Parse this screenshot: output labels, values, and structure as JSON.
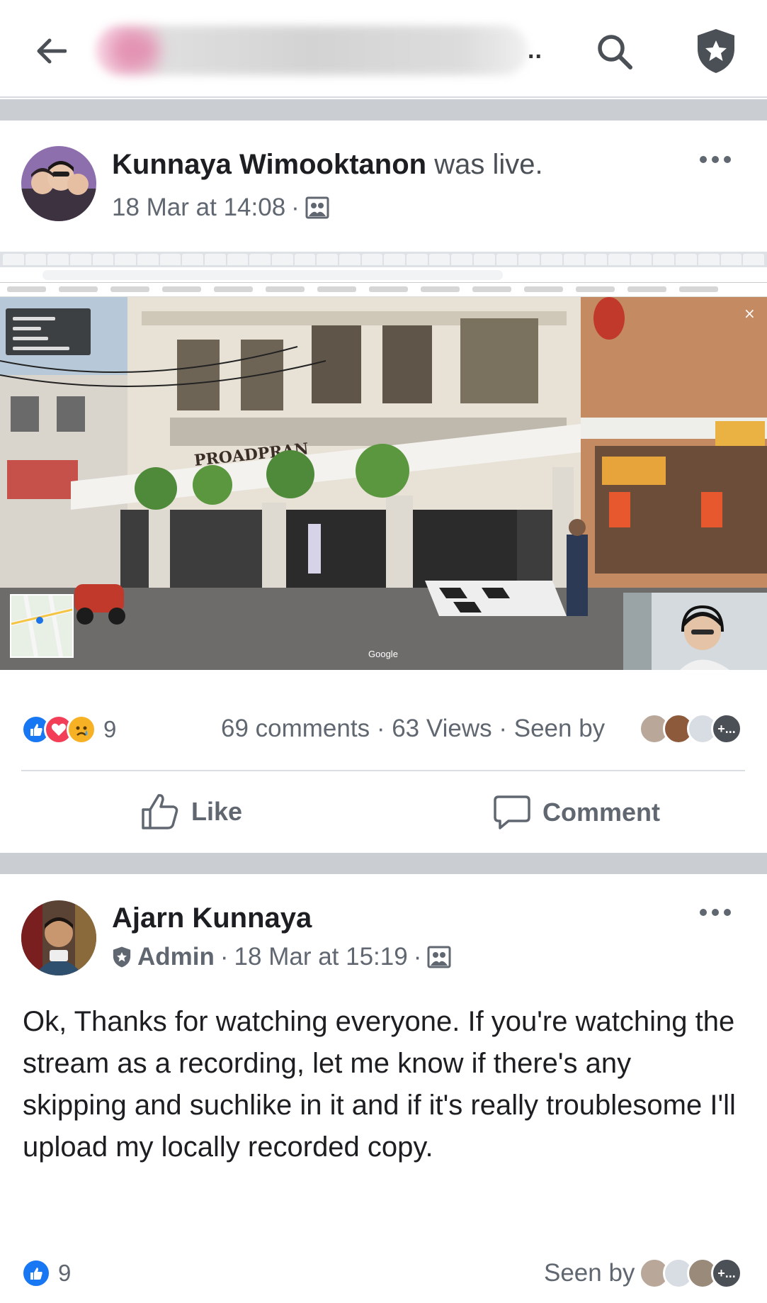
{
  "header": {
    "page_title": "",
    "title_suffix": ".."
  },
  "post1": {
    "author": "Kunnaya Wimooktanon",
    "author_suffix": "was live.",
    "timestamp": "18 Mar at 14:08",
    "stream_watermark": "Google",
    "reactions": {
      "count": "9",
      "types": [
        "like",
        "love",
        "sad"
      ]
    },
    "comments": "69 comments",
    "views": "63 Views",
    "seen_by_label": "Seen by",
    "seen_by_more": "+...",
    "actions": {
      "like_label": "Like",
      "comment_label": "Comment"
    }
  },
  "post2": {
    "author": "Ajarn Kunnaya",
    "role": "Admin",
    "timestamp": "18 Mar at 15:19",
    "text": "Ok, Thanks for watching everyone. If you're watching the stream as a recording, let me know if there's any skipping and suchlike in it and if it's really troublesome I'll upload my locally recorded copy.",
    "reactions": {
      "count": "9",
      "types": [
        "like"
      ]
    },
    "seen_by_label": "Seen by",
    "seen_by_more": "+..."
  },
  "colors": {
    "like_blue": "#1877f2",
    "love_red": "#f33e58",
    "sad_yellow": "#f7b125",
    "secondary_text": "#606770",
    "band": "#cacdd2"
  }
}
